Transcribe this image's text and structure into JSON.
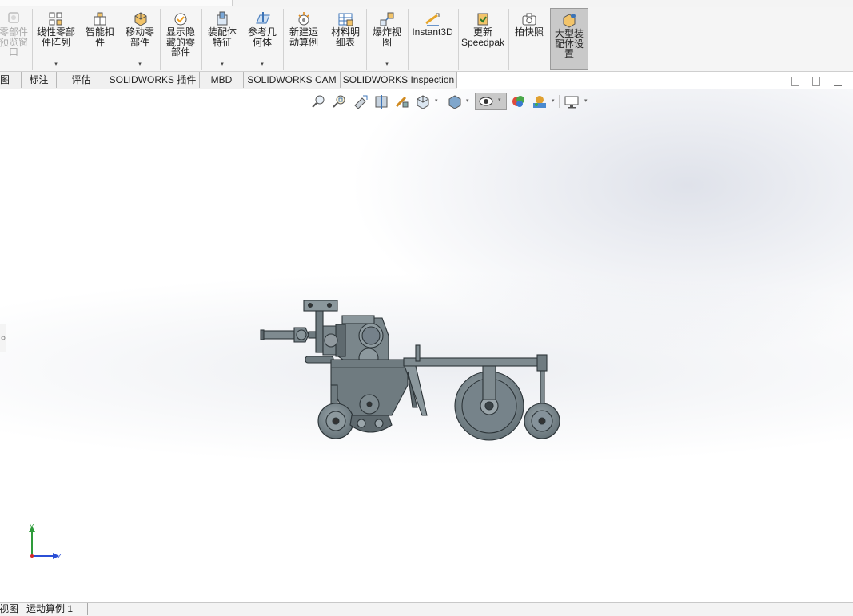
{
  "ribbon": {
    "buttons": [
      {
        "label": "零部件\n预览窗\n口",
        "state": "disabled"
      },
      {
        "label": "线性零部\n件阵列",
        "dropdown": true
      },
      {
        "label": "智能扣\n件"
      },
      {
        "label": "移动零\n部件",
        "dropdown": true
      },
      {
        "label": "显示隐\n藏的零\n部件"
      },
      {
        "label": "装配体\n特征",
        "dropdown": true
      },
      {
        "label": "参考几\n何体",
        "dropdown": true
      },
      {
        "label": "新建运\n动算例"
      },
      {
        "label": "材料明\n细表"
      },
      {
        "label": "爆炸视\n图",
        "dropdown": true
      },
      {
        "label": "Instant3D"
      },
      {
        "label": "更新\nSpeedpak"
      },
      {
        "label": "拍快照"
      },
      {
        "label": "大型装\n配体设\n置",
        "state": "active"
      }
    ],
    "caret": "▾"
  },
  "tabs": [
    "图",
    "标注",
    "评估",
    "SOLIDWORKS 插件",
    "MBD",
    "SOLIDWORKS CAM",
    "SOLIDWORKS Inspection"
  ],
  "hud": {
    "items": [
      "zoom-to-fit-icon",
      "zoom-to-area-icon",
      "previous-view-icon",
      "section-view-icon",
      "dynamic-annotation-icon",
      "view-orientation-icon",
      "display-style-icon",
      "hide-show-items-icon",
      "edit-appearance-icon",
      "apply-scene-icon",
      "view-settings-icon"
    ]
  },
  "triad": {
    "y": "Y",
    "z": "Z"
  },
  "bottom_tabs": [
    "视图",
    "运动算例 1"
  ],
  "colors": {
    "accent_active": "#c9c9c9",
    "model_gray": "#6f7b80",
    "axis_y": "#2e9b3a",
    "axis_z": "#2b4fd6",
    "axis_x": "#d42a2a"
  }
}
